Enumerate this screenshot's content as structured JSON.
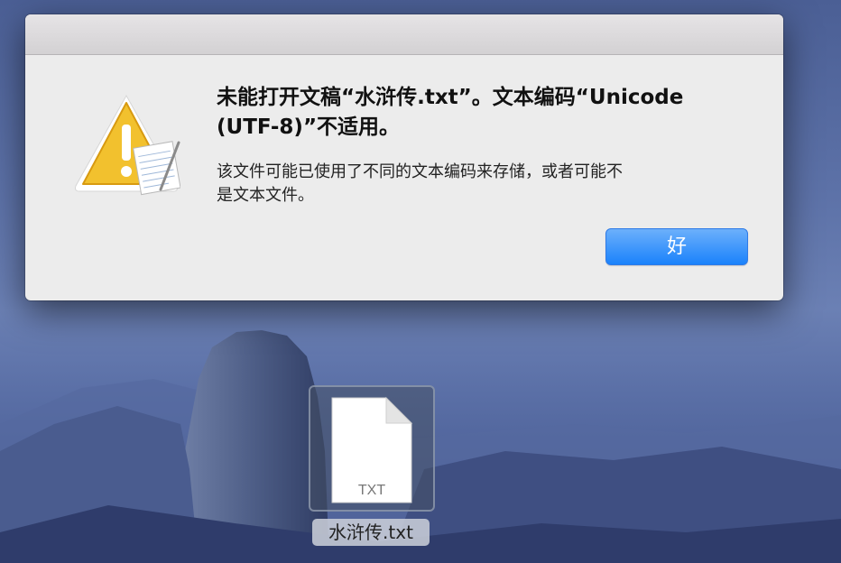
{
  "dialog": {
    "title_line1": "未能打开文稿“水浒传.txt”。文本编码“Unicode",
    "title_line2": "(UTF-8)”不适用。",
    "body_line1": "该文件可能已使用了不同的文本编码来存储，或者可能不",
    "body_line2": "是文本文件。",
    "ok_label": "好",
    "icon": "caution-textedit-icon"
  },
  "desktop": {
    "file_name": "水浒传.txt",
    "file_extension": "TXT",
    "file_icon": "text-document-icon"
  },
  "colors": {
    "accent": "#1a82fb",
    "warning": "#f2c12e"
  }
}
